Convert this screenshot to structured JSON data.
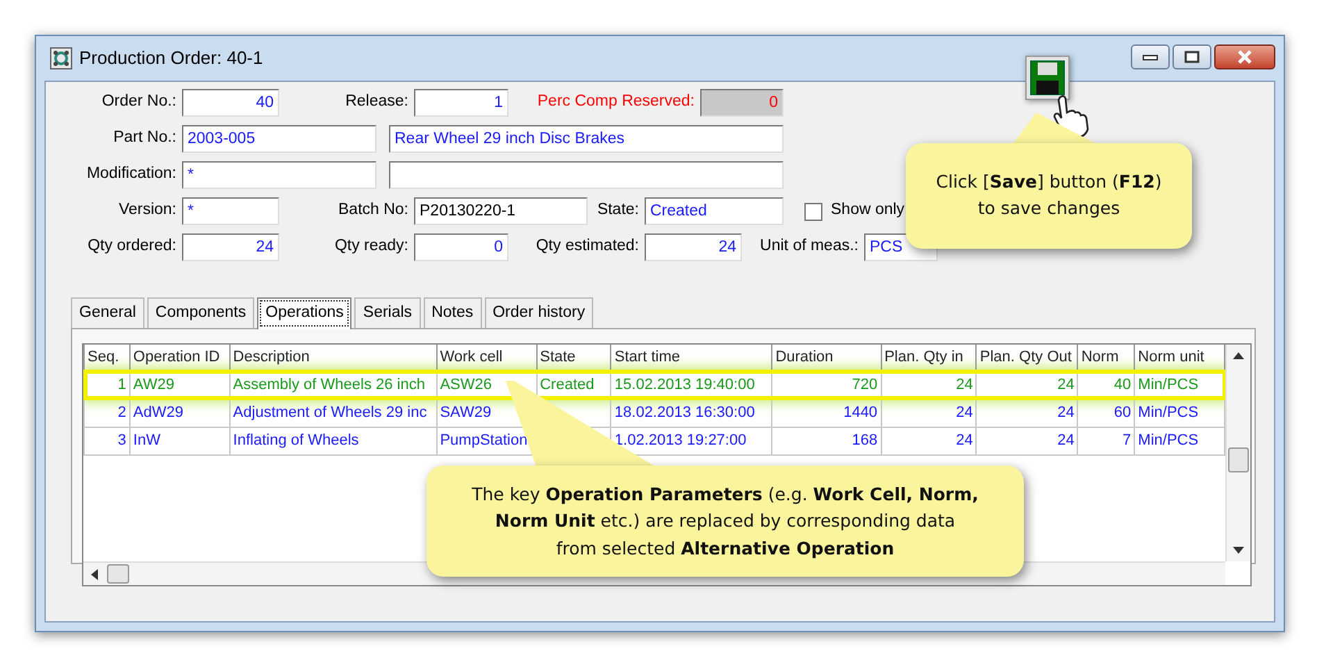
{
  "window": {
    "title": "Production Order: 40-1"
  },
  "save_button": {
    "callout": "Click [**Save**] button (**F12**)\nto save changes"
  },
  "form": {
    "rows": [
      [
        {
          "label": "Order No.:",
          "value": "40",
          "kind": "number"
        },
        {
          "label": "Release:",
          "value": "1",
          "kind": "number"
        },
        {
          "label": "Perc Comp Reserved:",
          "value": "0",
          "kind": "reserved"
        }
      ],
      [
        {
          "label": "Part No.:",
          "value": "2003-005",
          "kind": "text"
        },
        {
          "value": "Rear Wheel 29 inch Disc Brakes",
          "kind": "text"
        }
      ],
      [
        {
          "label": "Modification:",
          "value": "*",
          "kind": "text"
        },
        {
          "kind": "text"
        }
      ],
      [
        {
          "label": "Version:",
          "value": "*",
          "kind": "text"
        },
        {
          "label": "Batch No:",
          "value": "P20130220-1",
          "kind": "plain"
        },
        {
          "label": "State:",
          "value": "Created",
          "kind": "text"
        },
        {
          "label": "Show only",
          "kind": "checkbox",
          "checked": false
        }
      ],
      [
        {
          "label": "Qty ordered:",
          "value": "24",
          "kind": "number"
        },
        {
          "label": "Qty ready:",
          "value": "0",
          "kind": "number"
        },
        {
          "label": "Qty estimated:",
          "value": "24",
          "kind": "number"
        },
        {
          "label": "Unit of meas.:",
          "value": "PCS",
          "kind": "text"
        }
      ]
    ]
  },
  "tabs": [
    {
      "label": "General",
      "selected": false
    },
    {
      "label": "Components",
      "selected": false
    },
    {
      "label": "Operations",
      "selected": true
    },
    {
      "label": "Serials",
      "selected": false
    },
    {
      "label": "Notes",
      "selected": false
    },
    {
      "label": "Order history",
      "selected": false
    }
  ],
  "table": {
    "columns": [
      "Seq.",
      "Operation ID",
      "Description",
      "Work cell",
      "State",
      "Start time",
      "Duration",
      "Plan. Qty in",
      "Plan. Qty Out",
      "Norm",
      "Norm unit"
    ],
    "rows": [
      {
        "selected": true,
        "seq": "1",
        "operation_id": "AW29",
        "description": "Assembly of Wheels 26 inch",
        "work_cell": "ASW26",
        "state": "Created",
        "start_time": "15.02.2013 19:40:00",
        "duration": "720",
        "plan_qty_in": "24",
        "plan_qty_out": "24",
        "norm": "40",
        "norm_unit": "Min/PCS"
      },
      {
        "selected": false,
        "seq": "2",
        "operation_id": "AdW29",
        "description": "Adjustment of Wheels 29 inc",
        "work_cell": "SAW29",
        "start_time": "18.02.2013 16:30:00",
        "duration": "1440",
        "plan_qty_in": "24",
        "plan_qty_out": "24",
        "norm": "60",
        "norm_unit": "Min/PCS"
      },
      {
        "selected": false,
        "seq": "3",
        "operation_id": "InW",
        "description": "Inflating of Wheels",
        "work_cell": "PumpStation",
        "start_time": "1.02.2013 19:27:00",
        "duration": "168",
        "plan_qty_in": "24",
        "plan_qty_out": "24",
        "norm": "7",
        "norm_unit": "Min/PCS"
      }
    ],
    "callout": "The key **Operation Parameters** (e.g. **Work Cell, Norm,**\n**Norm Unit** etc.) are replaced by corresponding data\nfrom selected **Alternative Operation**"
  }
}
